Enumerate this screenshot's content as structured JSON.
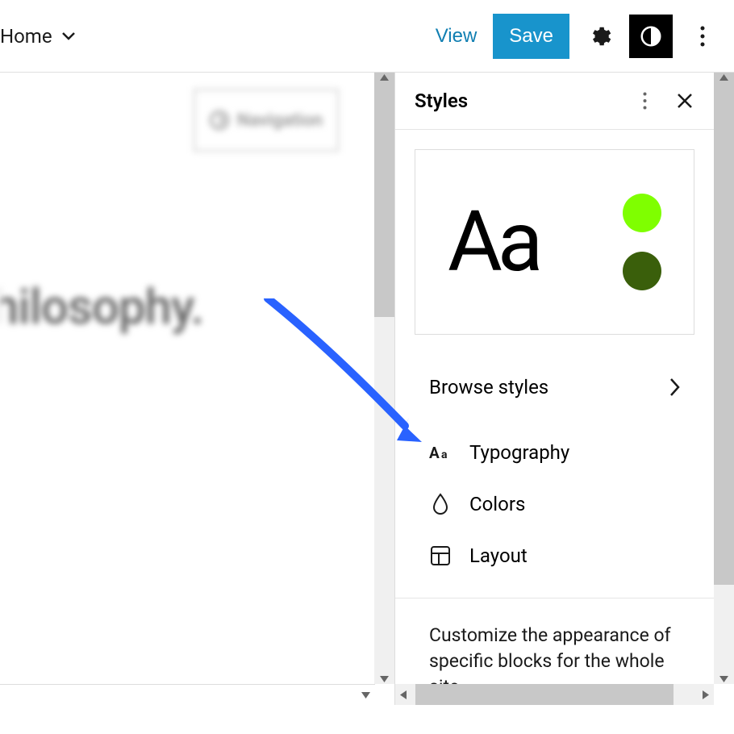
{
  "topbar": {
    "home_label": "Home",
    "view_label": "View",
    "save_label": "Save"
  },
  "canvas": {
    "navigation_label": "Navigation",
    "hilo_text": "hilosophy."
  },
  "sidebar": {
    "title": "Styles",
    "preview_sample": "Aa",
    "colors": {
      "light": "#7fff00",
      "dark": "#3a5f0b"
    },
    "browse_label": "Browse styles",
    "options": [
      {
        "label": "Typography",
        "icon": "typography"
      },
      {
        "label": "Colors",
        "icon": "droplet"
      },
      {
        "label": "Layout",
        "icon": "layout"
      }
    ],
    "customize_text": "Customize the appearance of specific blocks for the whole site."
  }
}
